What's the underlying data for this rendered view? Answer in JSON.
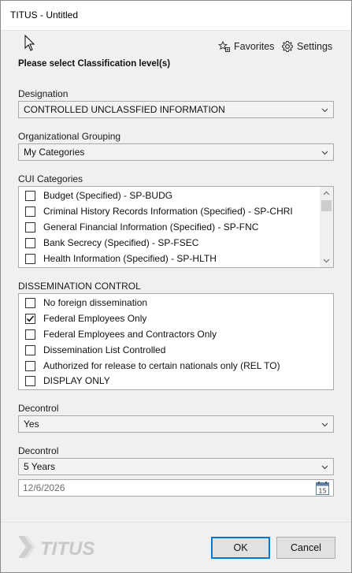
{
  "window": {
    "title": "TITUS - Untitled"
  },
  "toolbar": {
    "favorites_label": "Favorites",
    "settings_label": "Settings"
  },
  "header": {
    "subtitle": "Please select Classification level(s)"
  },
  "designation": {
    "label": "Designation",
    "value": "CONTROLLED UNCLASSFIED INFORMATION"
  },
  "org_grouping": {
    "label": "Organizational Grouping",
    "value": "My Categories"
  },
  "cui_categories": {
    "label": "CUI Categories",
    "items": [
      {
        "label": "Budget (Specified) - SP-BUDG",
        "checked": false
      },
      {
        "label": "Criminal History Records Information (Specified) - SP-CHRI",
        "checked": false
      },
      {
        "label": "General Financial Information (Specified) - SP-FNC",
        "checked": false
      },
      {
        "label": "Bank Secrecy (Specified) - SP-FSEC",
        "checked": false
      },
      {
        "label": "Health Information (Specified) - SP-HLTH",
        "checked": false
      }
    ]
  },
  "dissemination": {
    "label": "DISSEMINATION CONTROL",
    "items": [
      {
        "label": "No foreign dissemination",
        "checked": false
      },
      {
        "label": "Federal Employees Only",
        "checked": true
      },
      {
        "label": "Federal Employees and Contractors Only",
        "checked": false
      },
      {
        "label": "Dissemination List Controlled",
        "checked": false
      },
      {
        "label": "Authorized for release to certain nationals only (REL TO)",
        "checked": false
      },
      {
        "label": "DISPLAY ONLY",
        "checked": false
      }
    ]
  },
  "decontrol1": {
    "label": "Decontrol",
    "value": "Yes"
  },
  "decontrol2": {
    "label": "Decontrol",
    "value": "5 Years",
    "date_value": "12/6/2026"
  },
  "calendar": {
    "day": "15"
  },
  "footer": {
    "logo_text": "TITUS",
    "ok_label": "OK",
    "cancel_label": "Cancel"
  },
  "colors": {
    "accent": "#0078d7",
    "logo": "#c8c8c8",
    "field_bg": "#f3f3f3"
  }
}
